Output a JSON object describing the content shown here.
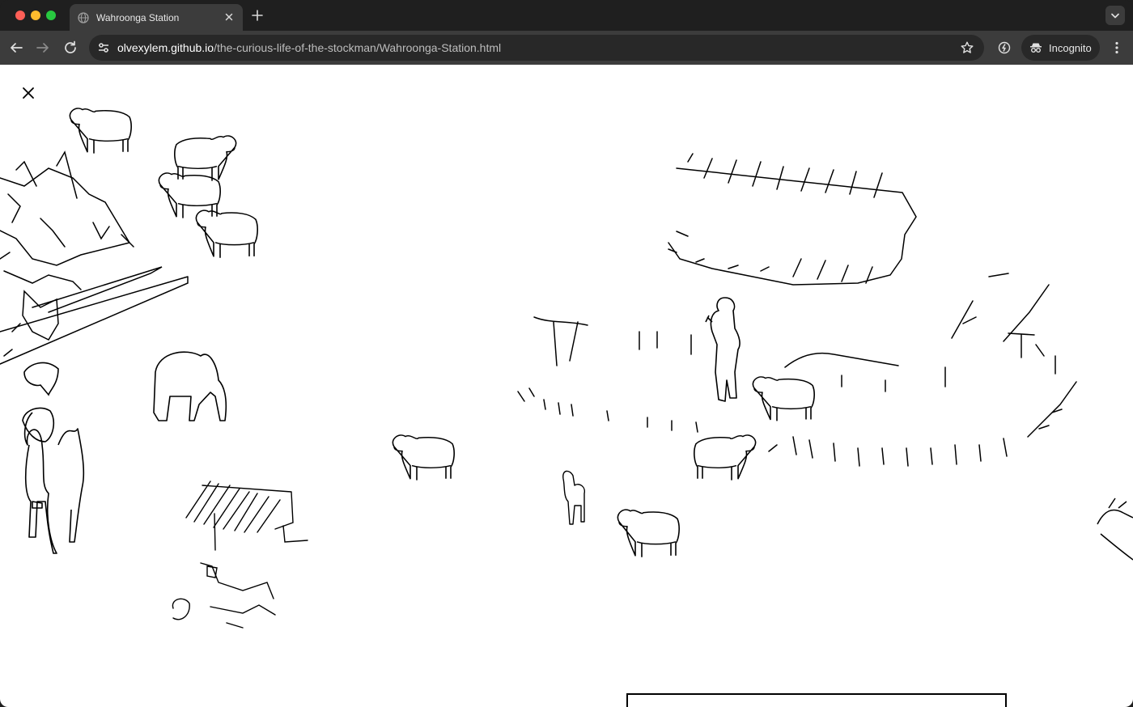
{
  "browser": {
    "tab": {
      "title": "Wahroonga Station",
      "icon": "globe-icon"
    },
    "address": {
      "host": "olvexylem.github.io",
      "path": "/the-curious-life-of-the-stockman/Wahroonga-Station.html"
    },
    "profile_label": "Incognito"
  },
  "page": {
    "close_icon": "close-icon",
    "scene_elements": [
      "sheep",
      "horse",
      "rider-on-horse",
      "stockman-figure",
      "llama",
      "homestead",
      "woodpile",
      "fence",
      "yard"
    ]
  }
}
